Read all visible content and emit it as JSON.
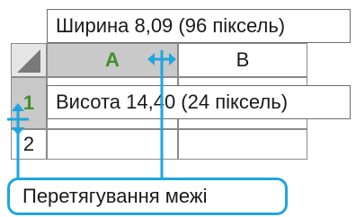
{
  "spreadsheet": {
    "columns": [
      {
        "label": "A",
        "selected": true
      },
      {
        "label": "B",
        "selected": false
      }
    ],
    "rows": [
      {
        "label": "1",
        "selected": true
      },
      {
        "label": "2",
        "selected": false
      }
    ]
  },
  "tooltips": {
    "width": "Ширина 8,09 (96 піксель)",
    "height": "Висота 14,40 (24 піксель)"
  },
  "callout": {
    "label": "Перетягування межі"
  },
  "colors": {
    "accent": "#1ea6dd",
    "selected_header_text": "#3f8f2a",
    "selected_header_bg": "#c9c9c9",
    "gridline": "#8a8a8a"
  },
  "icons": {
    "select_all": "select-all-triangle-icon",
    "column_resize": "horizontal-resize-cursor-icon",
    "row_resize": "vertical-resize-cursor-icon"
  }
}
